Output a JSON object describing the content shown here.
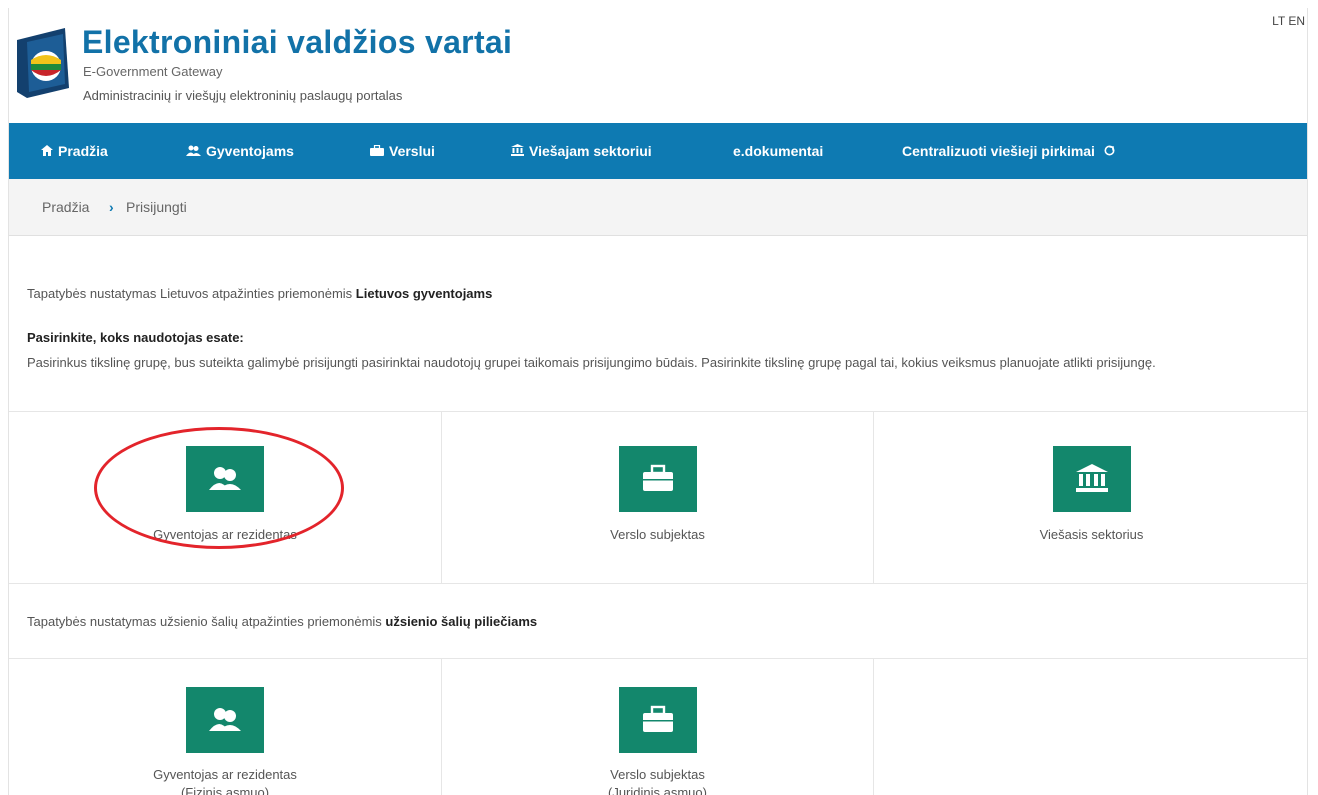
{
  "header": {
    "title": "Elektroniniai valdžios vartai",
    "subtitle": "E-Government Gateway",
    "description": "Administracinių ir viešųjų elektroninių paslaugų portalas",
    "lang_lt": "LT",
    "lang_en": "EN"
  },
  "nav": {
    "items": [
      {
        "label": "Pradžia",
        "icon": "home-icon"
      },
      {
        "label": "Gyventojams",
        "icon": "users-icon"
      },
      {
        "label": "Verslui",
        "icon": "briefcase-icon"
      },
      {
        "label": "Viešajam sektoriui",
        "icon": "bank-icon"
      },
      {
        "label": "e.dokumentai",
        "icon": ""
      },
      {
        "label": "Centralizuoti viešieji pirkimai",
        "icon": "external-link-icon"
      }
    ]
  },
  "breadcrumb": {
    "home": "Pradžia",
    "separator": "›",
    "current": "Prisijungti"
  },
  "content": {
    "intro_lt_prefix": "Tapatybės nustatymas Lietuvos atpažinties priemonėmis ",
    "intro_lt_bold": "Lietuvos gyventojams",
    "choose_title": "Pasirinkite, koks naudotojas esate:",
    "choose_desc": "Pasirinkus tikslinę grupę, bus suteikta galimybė prisijungti pasirinktai naudotojų grupei taikomais prisijungimo būdais. Pasirinkite tikslinę grupę pagal tai, kokius veiksmus planuojate atlikti prisijungę.",
    "intro_foreign_prefix": "Tapatybės nustatymas užsienio šalių atpažinties priemonėmis ",
    "intro_foreign_bold": "užsienio šalių piliečiams"
  },
  "tiles_lt": [
    {
      "label": "Gyventojas ar rezidentas",
      "icon": "users-icon"
    },
    {
      "label": "Verslo subjektas",
      "icon": "briefcase-icon"
    },
    {
      "label": "Viešasis sektorius",
      "icon": "bank-icon"
    }
  ],
  "tiles_foreign": [
    {
      "label1": "Gyventojas ar rezidentas",
      "label2": "(Fizinis asmuo)",
      "icon": "users-icon"
    },
    {
      "label1": "Verslo subjektas",
      "label2": "(Juridinis asmuo)",
      "icon": "briefcase-icon"
    }
  ],
  "colors": {
    "brand_blue": "#0e7ab2",
    "tile_green": "#13876c",
    "highlight_red": "#e3242b"
  }
}
